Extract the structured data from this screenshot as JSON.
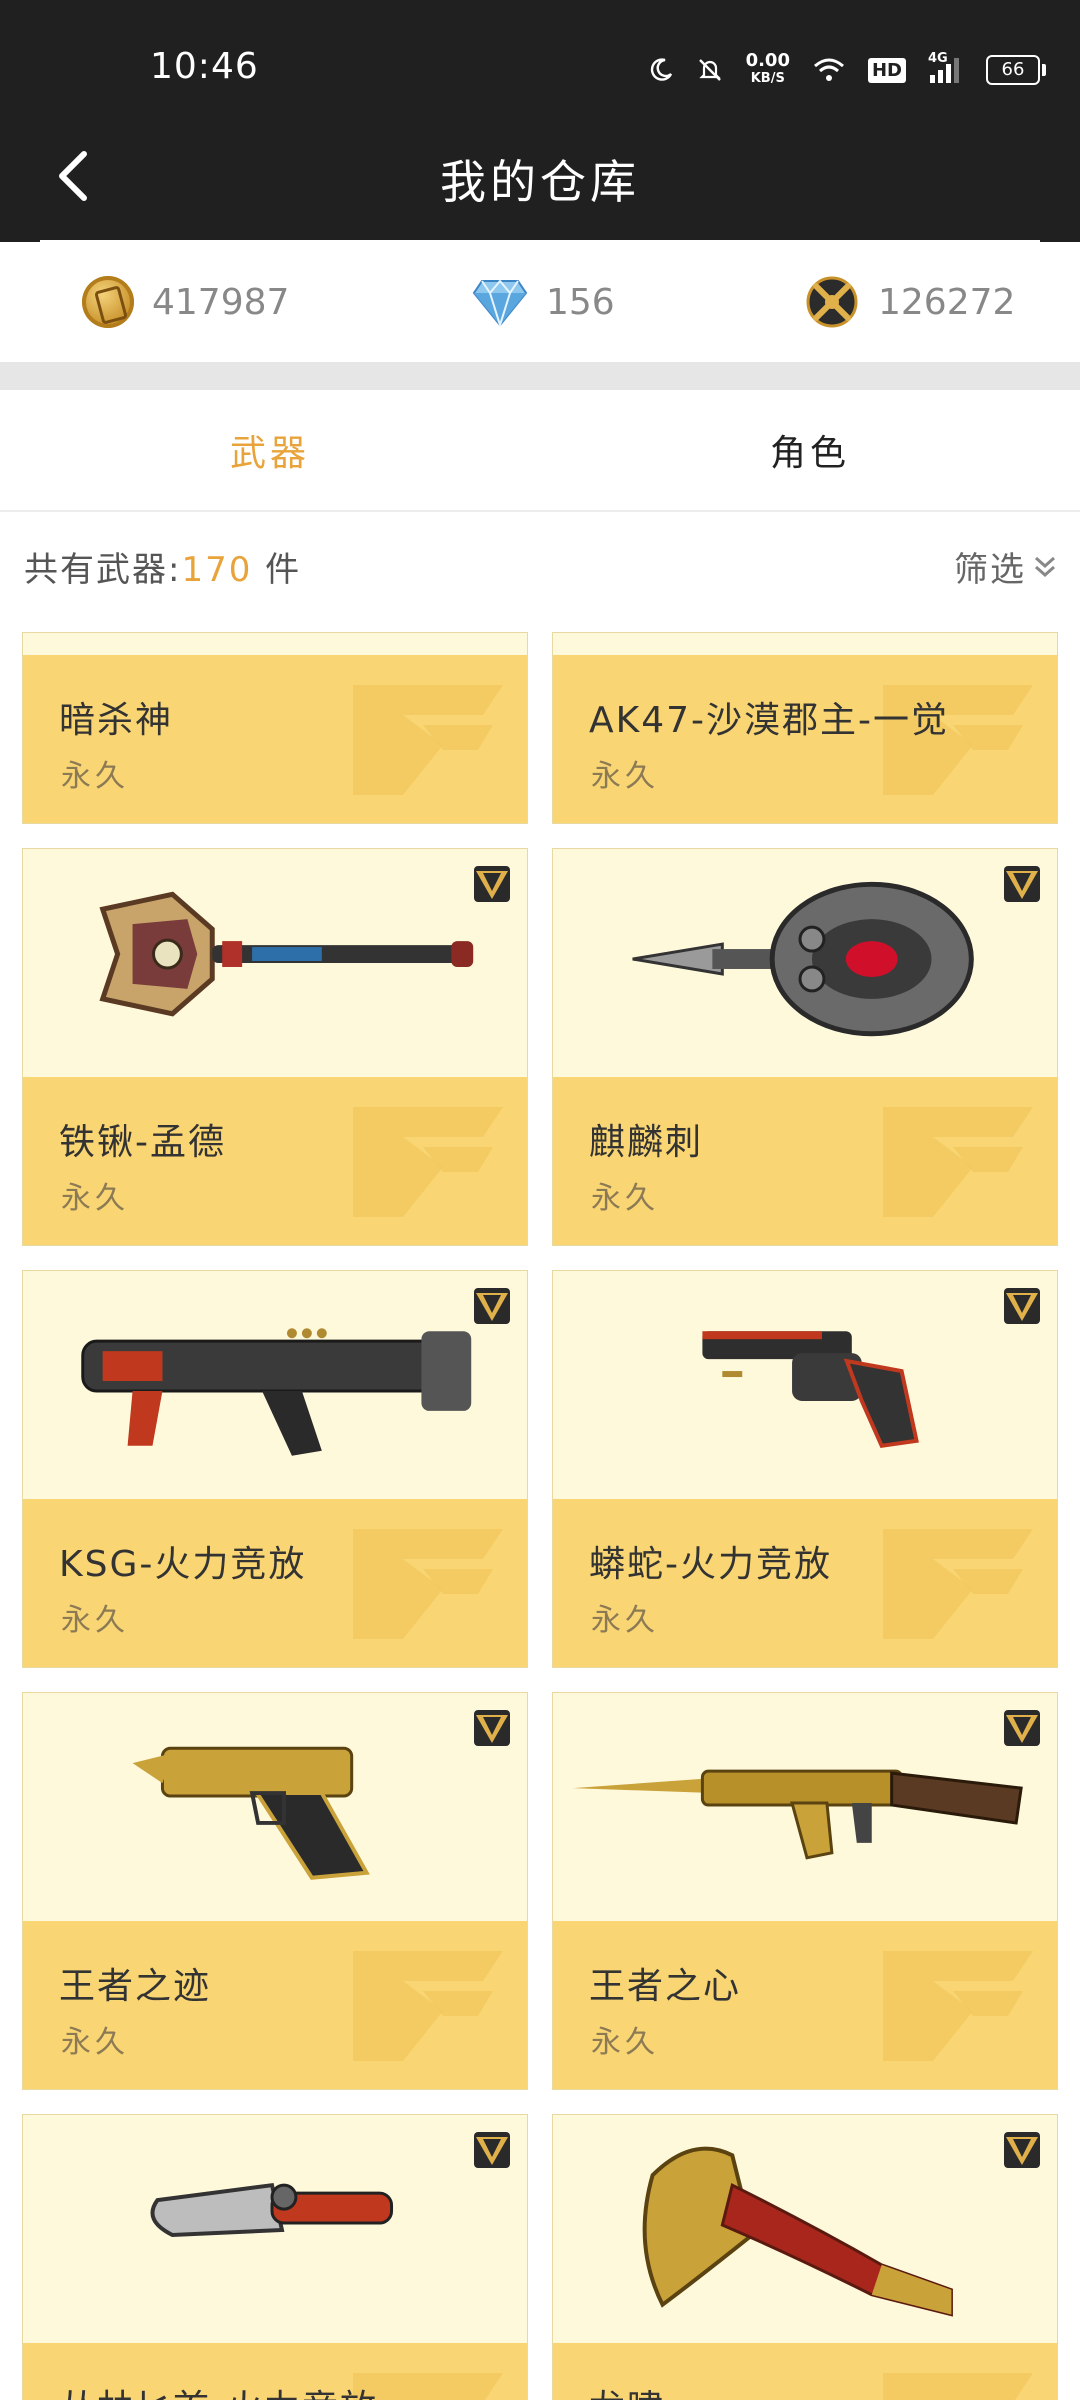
{
  "status_bar": {
    "time": "10:46",
    "net_speed": "0.00",
    "net_unit": "KB/S",
    "hd": "HD",
    "signal": "4G",
    "battery": "66"
  },
  "header": {
    "title": "我的仓库"
  },
  "currencies": {
    "gold": "417987",
    "diamond": "156",
    "honor": "126272"
  },
  "tabs": [
    {
      "label": "武器",
      "active": true
    },
    {
      "label": "角色",
      "active": false
    }
  ],
  "summary": {
    "prefix": "共有武器:",
    "count": "170",
    "suffix": " 件",
    "filter_label": "筛选"
  },
  "items": [
    {
      "name": "暗杀神",
      "duration": "永久",
      "icon": "knife-icon"
    },
    {
      "name": "AK47-沙漠郡主-一觉",
      "duration": "永久",
      "icon": "rifle-icon"
    },
    {
      "name": "铁锹-孟德",
      "duration": "永久",
      "icon": "shovel-icon"
    },
    {
      "name": "麒麟刺",
      "duration": "永久",
      "icon": "knuckle-blade-icon"
    },
    {
      "name": "KSG-火力竞放",
      "duration": "永久",
      "icon": "shotgun-icon"
    },
    {
      "name": "蟒蛇-火力竞放",
      "duration": "永久",
      "icon": "revolver-icon"
    },
    {
      "name": "王者之迹",
      "duration": "永久",
      "icon": "pistol-icon"
    },
    {
      "name": "王者之心",
      "duration": "永久",
      "icon": "rifle-icon"
    },
    {
      "name": "丛林匕首-火力竞放",
      "duration": "永久",
      "icon": "knife-icon"
    },
    {
      "name": "龙啸",
      "duration": "永久",
      "icon": "axe-icon"
    }
  ],
  "colors": {
    "accent": "#e8a33a",
    "card_bottom": "#f9d673",
    "card_top": "#fff9dc",
    "header_bg": "#202020"
  }
}
